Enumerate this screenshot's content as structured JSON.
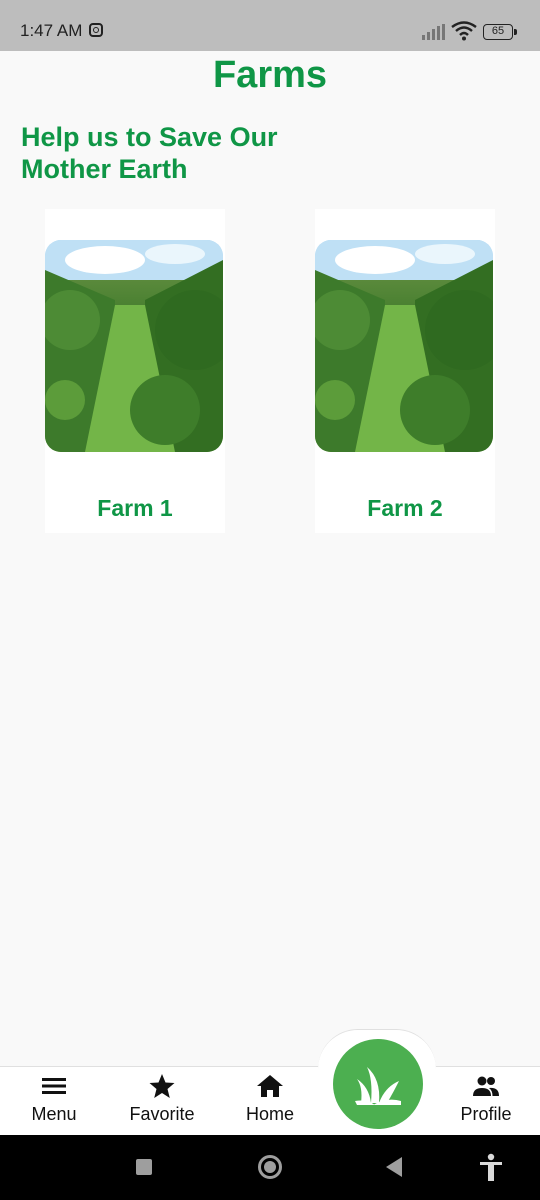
{
  "status_bar": {
    "time": "1:47 AM",
    "battery": "65"
  },
  "header": {
    "title": "Farms",
    "subtitle": "Help us to Save Our Mother Earth"
  },
  "farms": [
    {
      "label": "Farm 1"
    },
    {
      "label": "Farm 2"
    }
  ],
  "bottom_nav": {
    "items": [
      {
        "label": "Menu",
        "icon": "menu-icon"
      },
      {
        "label": "Favorite",
        "icon": "star-icon"
      },
      {
        "label": "Home",
        "icon": "home-icon"
      },
      {
        "label": "",
        "icon": "plant-icon"
      },
      {
        "label": "Profile",
        "icon": "people-icon"
      }
    ]
  },
  "colors": {
    "accent_green": "#0f9646",
    "fab_green": "#4caf50",
    "status_bar_gray": "#bdbdbd"
  }
}
